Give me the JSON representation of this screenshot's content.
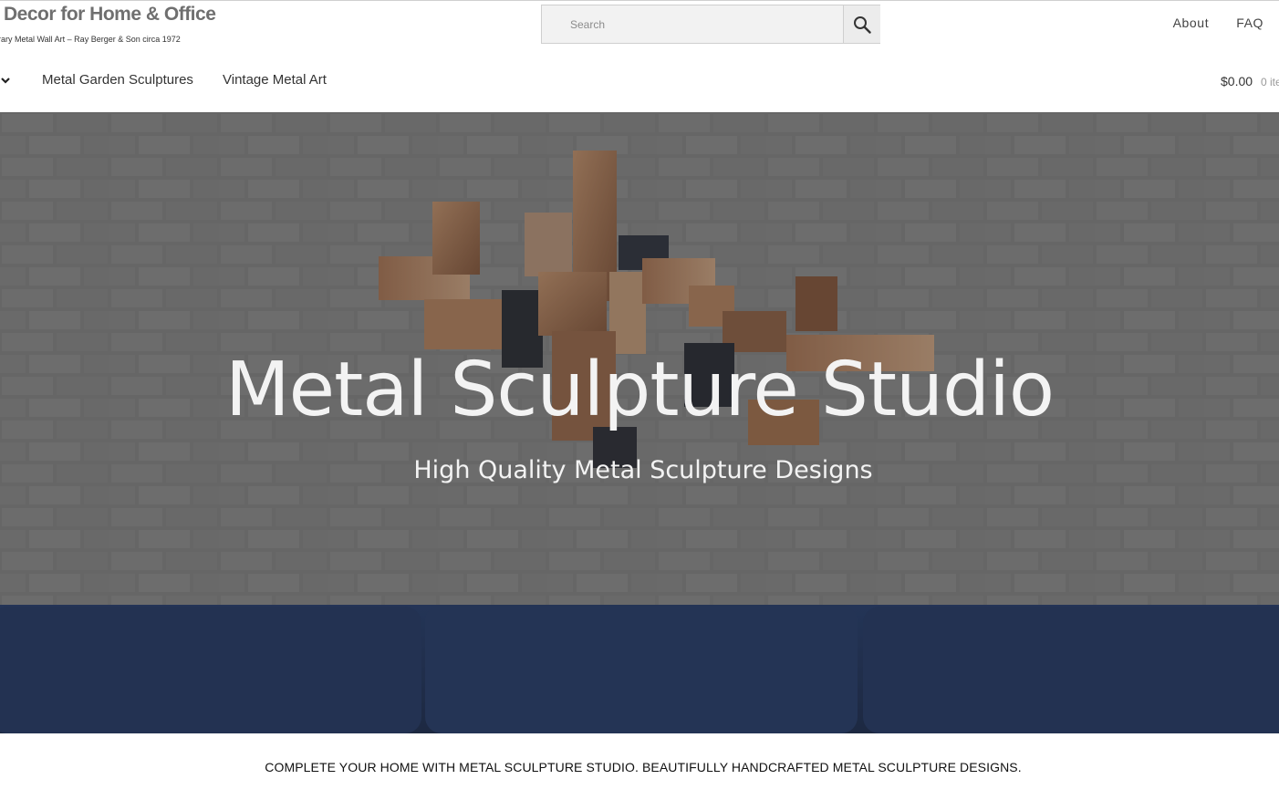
{
  "header": {
    "site_title": "Decor for Home & Office",
    "tagline": "rary Metal Wall Art – Ray Berger & Son circa 1972",
    "search": {
      "placeholder": "Search",
      "value": ""
    },
    "links": [
      {
        "label": "About"
      },
      {
        "label": "FAQ"
      }
    ]
  },
  "nav": {
    "items": [
      {
        "label": "Metal Garden Sculptures"
      },
      {
        "label": "Vintage Metal Art"
      }
    ],
    "cart": {
      "total": "$0.00",
      "count": "0 ite"
    }
  },
  "hero": {
    "title": "Metal Sculpture Studio",
    "subtitle": "High Quality Metal Sculpture Designs"
  },
  "tagline_bar": {
    "text": "COMPLETE YOUR HOME WITH METAL SCULPTURE STUDIO. BEAUTIFULLY HANDCRAFTED METAL SCULPTURE DESIGNS."
  },
  "colors": {
    "sofa": "#1d3566",
    "wall": "#8a8a8a",
    "copper": "#b07850"
  }
}
